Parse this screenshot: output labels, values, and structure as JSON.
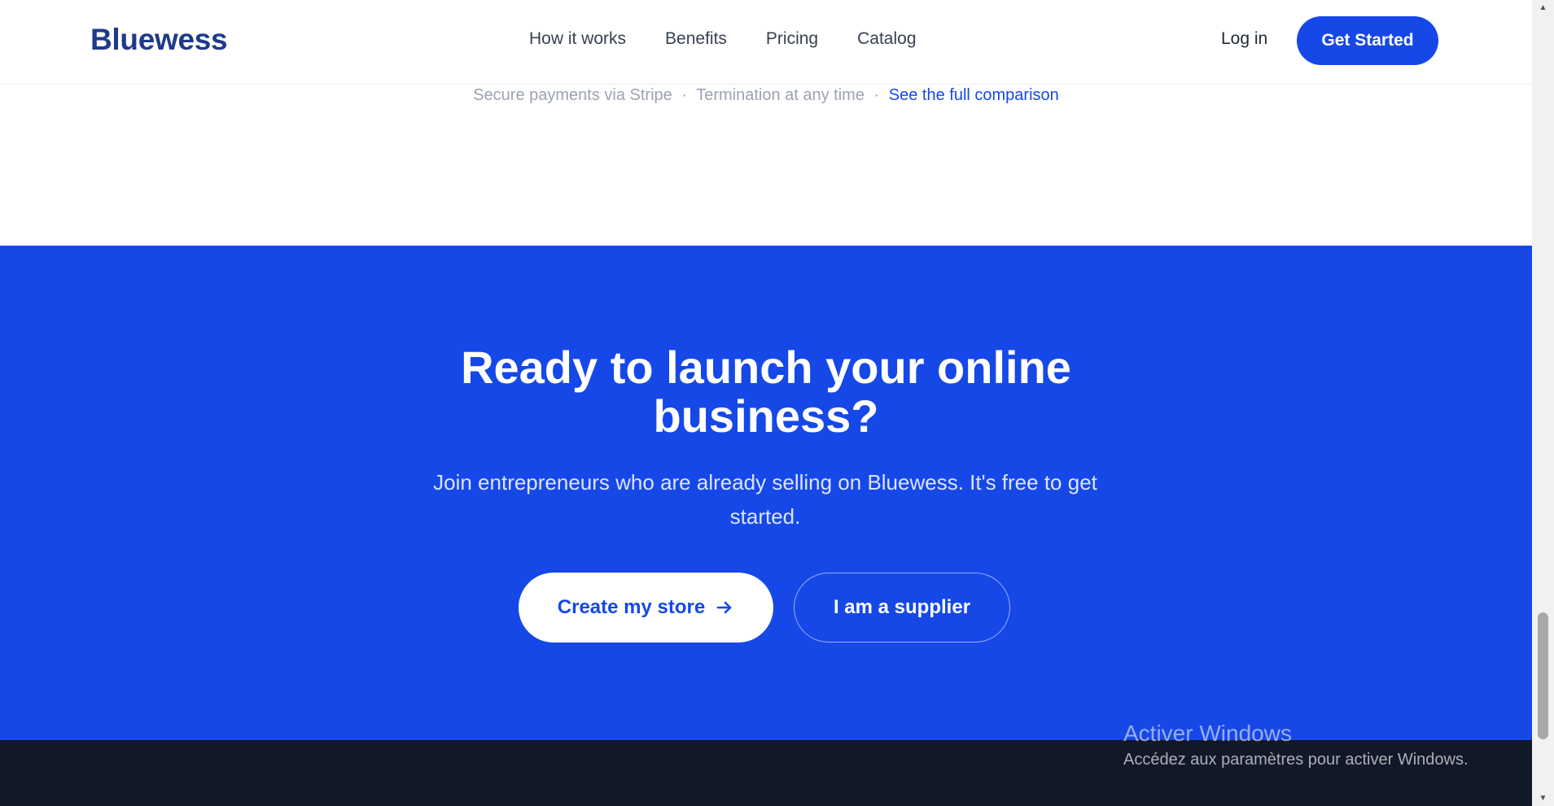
{
  "header": {
    "logo": "Bluewess",
    "nav": [
      "How it works",
      "Benefits",
      "Pricing",
      "Catalog"
    ],
    "login": "Log in",
    "get_started": "Get Started"
  },
  "secure_line": {
    "part1": "Secure payments via Stripe",
    "separator": "·",
    "part2": "Termination at any time",
    "link": "See the full comparison"
  },
  "cta": {
    "title_line1": "Ready to launch your online",
    "title_line2": "business?",
    "subtitle": "Join entrepreneurs who are already selling on Bluewess. It's free to get started.",
    "create_store": "Create my store",
    "supplier": "I am a supplier"
  },
  "watermark": {
    "title": "Activer Windows",
    "subtitle": "Accédez aux paramètres pour activer Windows."
  },
  "colors": {
    "brand_blue": "#1648e8",
    "logo_blue": "#1f3a8a",
    "footer_dark": "#111827"
  },
  "icons": {
    "arrow": "arrow-right-icon"
  }
}
